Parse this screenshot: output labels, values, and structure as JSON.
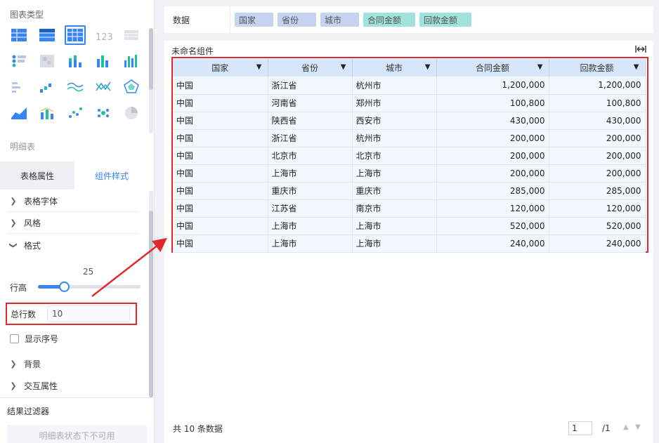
{
  "sidebar": {
    "chart_type_title": "图表类型",
    "detail_table_label": "明细表",
    "chart_icons": [
      "table-basic-icon",
      "table-group-icon",
      "table-cross-icon",
      "number-card-icon",
      "table-detail-icon",
      "dot-matrix-icon",
      "heatmap-icon",
      "stacked-bar-icon",
      "bar-chart-icon",
      "column-chart-icon",
      "bar-matrix-icon",
      "waterfall-icon",
      "line-wave-icon",
      "line-cross-icon",
      "radar-icon",
      "area-chart-icon",
      "combo-chart-icon",
      "scatter-icon",
      "bubble-icon",
      "pie-chart-icon"
    ],
    "tabs": [
      {
        "label": "表格属性",
        "active": false
      },
      {
        "label": "组件样式",
        "active": true
      }
    ],
    "props": {
      "font": "表格字体",
      "style": "风格",
      "format": "格式",
      "row_height_label": "行高",
      "row_height_value": "25",
      "row_height_fraction": 0.26,
      "total_rows_label": "总行数",
      "total_rows_value": "10",
      "show_index_label": "显示序号",
      "background": "背景",
      "interaction": "交互属性"
    },
    "filter_title": "结果过滤器",
    "filter_placeholder": "明细表状态下不可用"
  },
  "data_bar": {
    "label": "数据",
    "fields": [
      {
        "name": "国家",
        "kind": "dimension"
      },
      {
        "name": "省份",
        "kind": "dimension"
      },
      {
        "name": "城市",
        "kind": "dimension"
      },
      {
        "name": "合同金额",
        "kind": "measure"
      },
      {
        "name": "回款金额",
        "kind": "measure"
      }
    ]
  },
  "component": {
    "title": "未命名组件",
    "columns": [
      "国家",
      "省份",
      "城市",
      "合同金额",
      "回款金额"
    ],
    "rows": [
      [
        "中国",
        "浙江省",
        "杭州市",
        "1,200,000",
        "1,200,000"
      ],
      [
        "中国",
        "河南省",
        "郑州市",
        "100,800",
        "100,800"
      ],
      [
        "中国",
        "陕西省",
        "西安市",
        "430,000",
        "430,000"
      ],
      [
        "中国",
        "浙江省",
        "杭州市",
        "200,000",
        "200,000"
      ],
      [
        "中国",
        "北京市",
        "北京市",
        "200,000",
        "200,000"
      ],
      [
        "中国",
        "上海市",
        "上海市",
        "200,000",
        "200,000"
      ],
      [
        "中国",
        "重庆市",
        "重庆市",
        "285,000",
        "285,000"
      ],
      [
        "中国",
        "江苏省",
        "南京市",
        "120,000",
        "120,000"
      ],
      [
        "中国",
        "上海市",
        "上海市",
        "520,000",
        "520,000"
      ],
      [
        "中国",
        "上海市",
        "上海市",
        "240,000",
        "240,000"
      ]
    ],
    "footer": "共 10 条数据",
    "page_current": "1",
    "page_total": "/1"
  },
  "colors": {
    "accent": "#3685f2",
    "highlight": "#e0282e",
    "dimension_pill": "#c4d3f0",
    "measure_pill": "#9fe3dc"
  }
}
